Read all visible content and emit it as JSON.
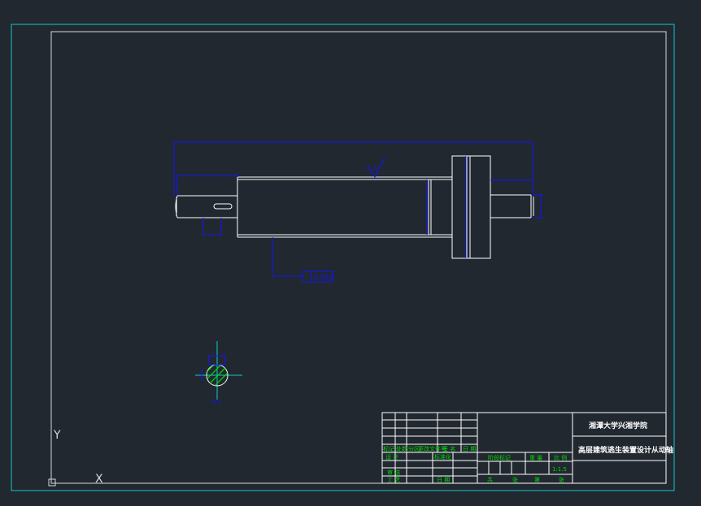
{
  "app": {
    "background": "#212830"
  },
  "colors": {
    "frame_outer": "#14c8c8",
    "frame_inner": "#d8d8d8",
    "geometry": "#ffffff",
    "dimension": "#1414ff",
    "centerline": "#ff3030",
    "section_hatch": "#00d800",
    "section_axis": "#14c8c8",
    "titleblock_text": "#00d800",
    "titleblock_school": "#ffffff"
  },
  "drawing": {
    "roughness_symbol": "6.3",
    "tolerance_label": "0.030",
    "section_label": "A-A",
    "ucs_icon": {
      "x_label": "X",
      "y_label": "Y"
    }
  },
  "title_block": {
    "school": "湘潭大学兴湘学院",
    "title": "高层建筑逃生装置设计从动轴",
    "scale": "1:1.5",
    "left_row_labels": [
      "标记",
      "处数",
      "分区",
      "更改文件号",
      "签 名",
      "日 期"
    ],
    "design_label": "设 计",
    "standardize_label": "标准化",
    "review_label": "审 核",
    "process_label": "工 艺",
    "date_label": "日 期",
    "stage_label": "阶段标记",
    "weight_label": "重 量",
    "ratio_label": "比 例",
    "total_label": "共",
    "sheet_unit": "张",
    "page_label": "第"
  }
}
